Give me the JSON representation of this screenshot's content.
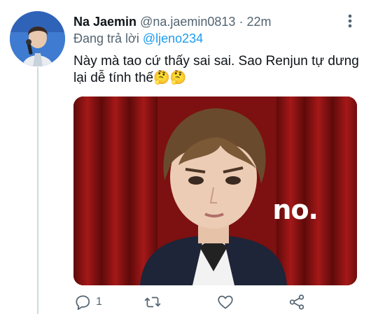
{
  "tweet": {
    "display_name": "Na Jaemin",
    "handle": "@na.jaemin0813",
    "separator": "·",
    "time": "22m",
    "reply_prefix": "Đang trả lời",
    "reply_mention": "@ljeno234",
    "text_line1": "Này mà tao cứ thấy sai sai. Sao Renjun tự dưng",
    "text_line2": "lại dễ tính thế🤔🤔",
    "media_caption": "no."
  },
  "actions": {
    "reply_count": "1"
  },
  "icons": {
    "more": "more-vertical-icon",
    "reply": "reply-icon",
    "retweet": "retweet-icon",
    "like": "heart-icon",
    "share": "share-icon"
  },
  "colors": {
    "text": "#0f1419",
    "secondary": "#536471",
    "link": "#1d9bf0",
    "thread_line": "#cfd9de"
  }
}
